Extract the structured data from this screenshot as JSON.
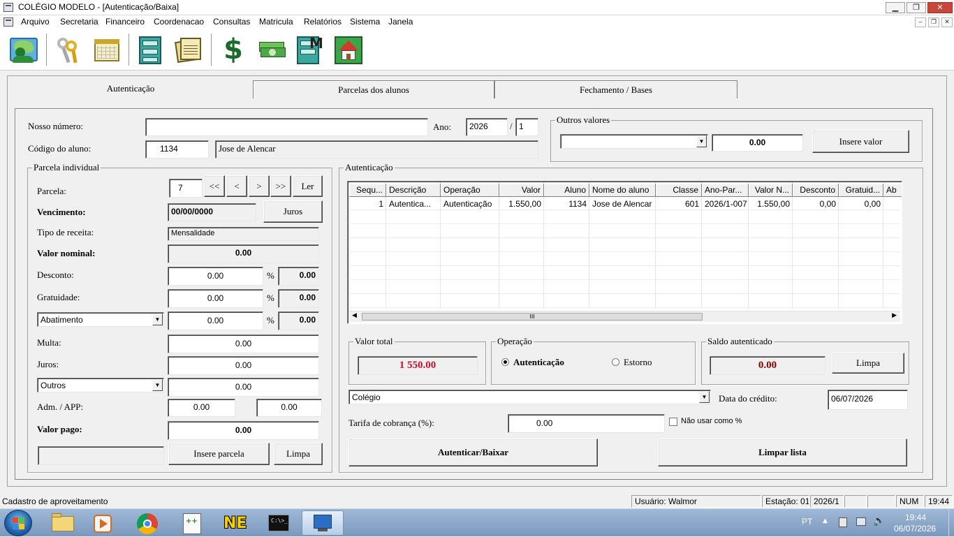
{
  "window": {
    "title": "COLÉGIO MODELO - [Autenticação/Baixa]",
    "minimize": "▁",
    "maximize": "❐",
    "close": "✕"
  },
  "menu": [
    "Arquivo",
    "Secretaria",
    "Financeiro",
    "Coordenacao",
    "Consultas",
    "Matricula",
    "Relatórios",
    "Sistema",
    "Janela"
  ],
  "mdi_controls": [
    "‒",
    "❐",
    "✕"
  ],
  "toolbar": [
    "user-map-icon",
    "keys-icon",
    "calendar-icon",
    "file-cabinet-icon",
    "documents-icon",
    "dollar-icon",
    "money-icon",
    "file-cabinet-m-icon",
    "home-icon"
  ],
  "tabs": {
    "t1": "Autenticação",
    "t2": "Parcelas dos alunos",
    "t3": "Fechamento / Bases"
  },
  "top": {
    "nosso_numero_label": "Nosso número:",
    "nosso_numero": "",
    "ano_label": "Ano:",
    "ano": "2026",
    "ano_sep": "/",
    "ano_parte": "1",
    "codigo_label": "Código do aluno:",
    "codigo": "1134",
    "aluno_nome": "Jose de Alencar"
  },
  "outros_valores": {
    "title": "Outros valores",
    "combo": "",
    "valor": "0.00",
    "button": "Insere valor"
  },
  "parcela": {
    "title": "Parcela individual",
    "parcela_label": "Parcela:",
    "parcela": "7",
    "nav": {
      "first": "<<",
      "prev": "<",
      "next": ">",
      "last": ">>",
      "ler": "Ler"
    },
    "vencimento_label": "Vencimento:",
    "vencimento": "00/00/0000",
    "juros_button": "Juros",
    "tipo_label": "Tipo de receita:",
    "tipo": "Mensalidade",
    "valor_nominal_label": "Valor nominal:",
    "valor_nominal": "0.00",
    "desconto_label": "Desconto:",
    "desconto": "0.00",
    "desconto_pct": "0.00",
    "gratuidade_label": "Gratuidade:",
    "gratuidade": "0.00",
    "gratuidade_pct": "0.00",
    "abatimento_combo": "Abatimento",
    "abatimento": "0.00",
    "abatimento_pct": "0.00",
    "pct": "%",
    "multa_label": "Multa:",
    "multa": "0.00",
    "juros_label": "Juros:",
    "juros": "0.00",
    "outros_combo": "Outros",
    "outros": "0.00",
    "adm_label": "Adm. / APP:",
    "adm": "0.00",
    "app": "0.00",
    "valor_pago_label": "Valor pago:",
    "valor_pago": "0.00",
    "insere_button": "Insere parcela",
    "limpa_button": "Limpa"
  },
  "autenticacao": {
    "title": "Autenticação",
    "columns": [
      "Sequ...",
      "Descrição",
      "Operação",
      "Valor",
      "Aluno",
      "Nome do aluno",
      "Classe",
      "Ano-Par...",
      "Valor N...",
      "Desconto",
      "Gratuid...",
      "Ab"
    ],
    "rows": [
      [
        "1",
        "Autentica...",
        "Autenticação",
        "1.550,00",
        "1134",
        "Jose de Alencar",
        "601",
        "2026/1-007",
        "1.550,00",
        "0,00",
        "0,00",
        ""
      ]
    ],
    "scroll_thumb": "III"
  },
  "valor_total": {
    "title": "Valor total",
    "value": "1 550.00"
  },
  "operacao": {
    "title": "Operação",
    "opt1": "Autenticação",
    "opt2": "Estorno",
    "selected": "Autenticação"
  },
  "saldo": {
    "title": "Saldo autenticado",
    "value": "0.00",
    "button": "Limpa"
  },
  "banco": {
    "combo": "Colégio",
    "data_label": "Data do crédito:",
    "data": "06/07/2026"
  },
  "tarifa": {
    "label": "Tarifa de cobrança (%):",
    "value": "0.00",
    "check_label": "Não usar como %"
  },
  "actions": {
    "autenticar": "Autenticar/Baixar",
    "limpar": "Limpar lista"
  },
  "status": {
    "left": "Cadastro de aproveitamento",
    "usuario": "Usuário: Walmor",
    "estacao": "Estação: 01",
    "periodo": "2026/1",
    "num": "NUM",
    "hora": "19:44"
  },
  "taskbar": {
    "lang": "PT",
    "time": "19:44",
    "date": "06/07/2026",
    "apps": [
      "explorer-icon",
      "media-player-icon",
      "chrome-icon",
      "notepad-plus-icon",
      "ne-icon",
      "cmd-icon",
      "network-app-icon"
    ]
  },
  "colors": {
    "accent_red": "#c8102e",
    "dark_red": "#8b0000",
    "taskbar": "#8aa6c8"
  }
}
